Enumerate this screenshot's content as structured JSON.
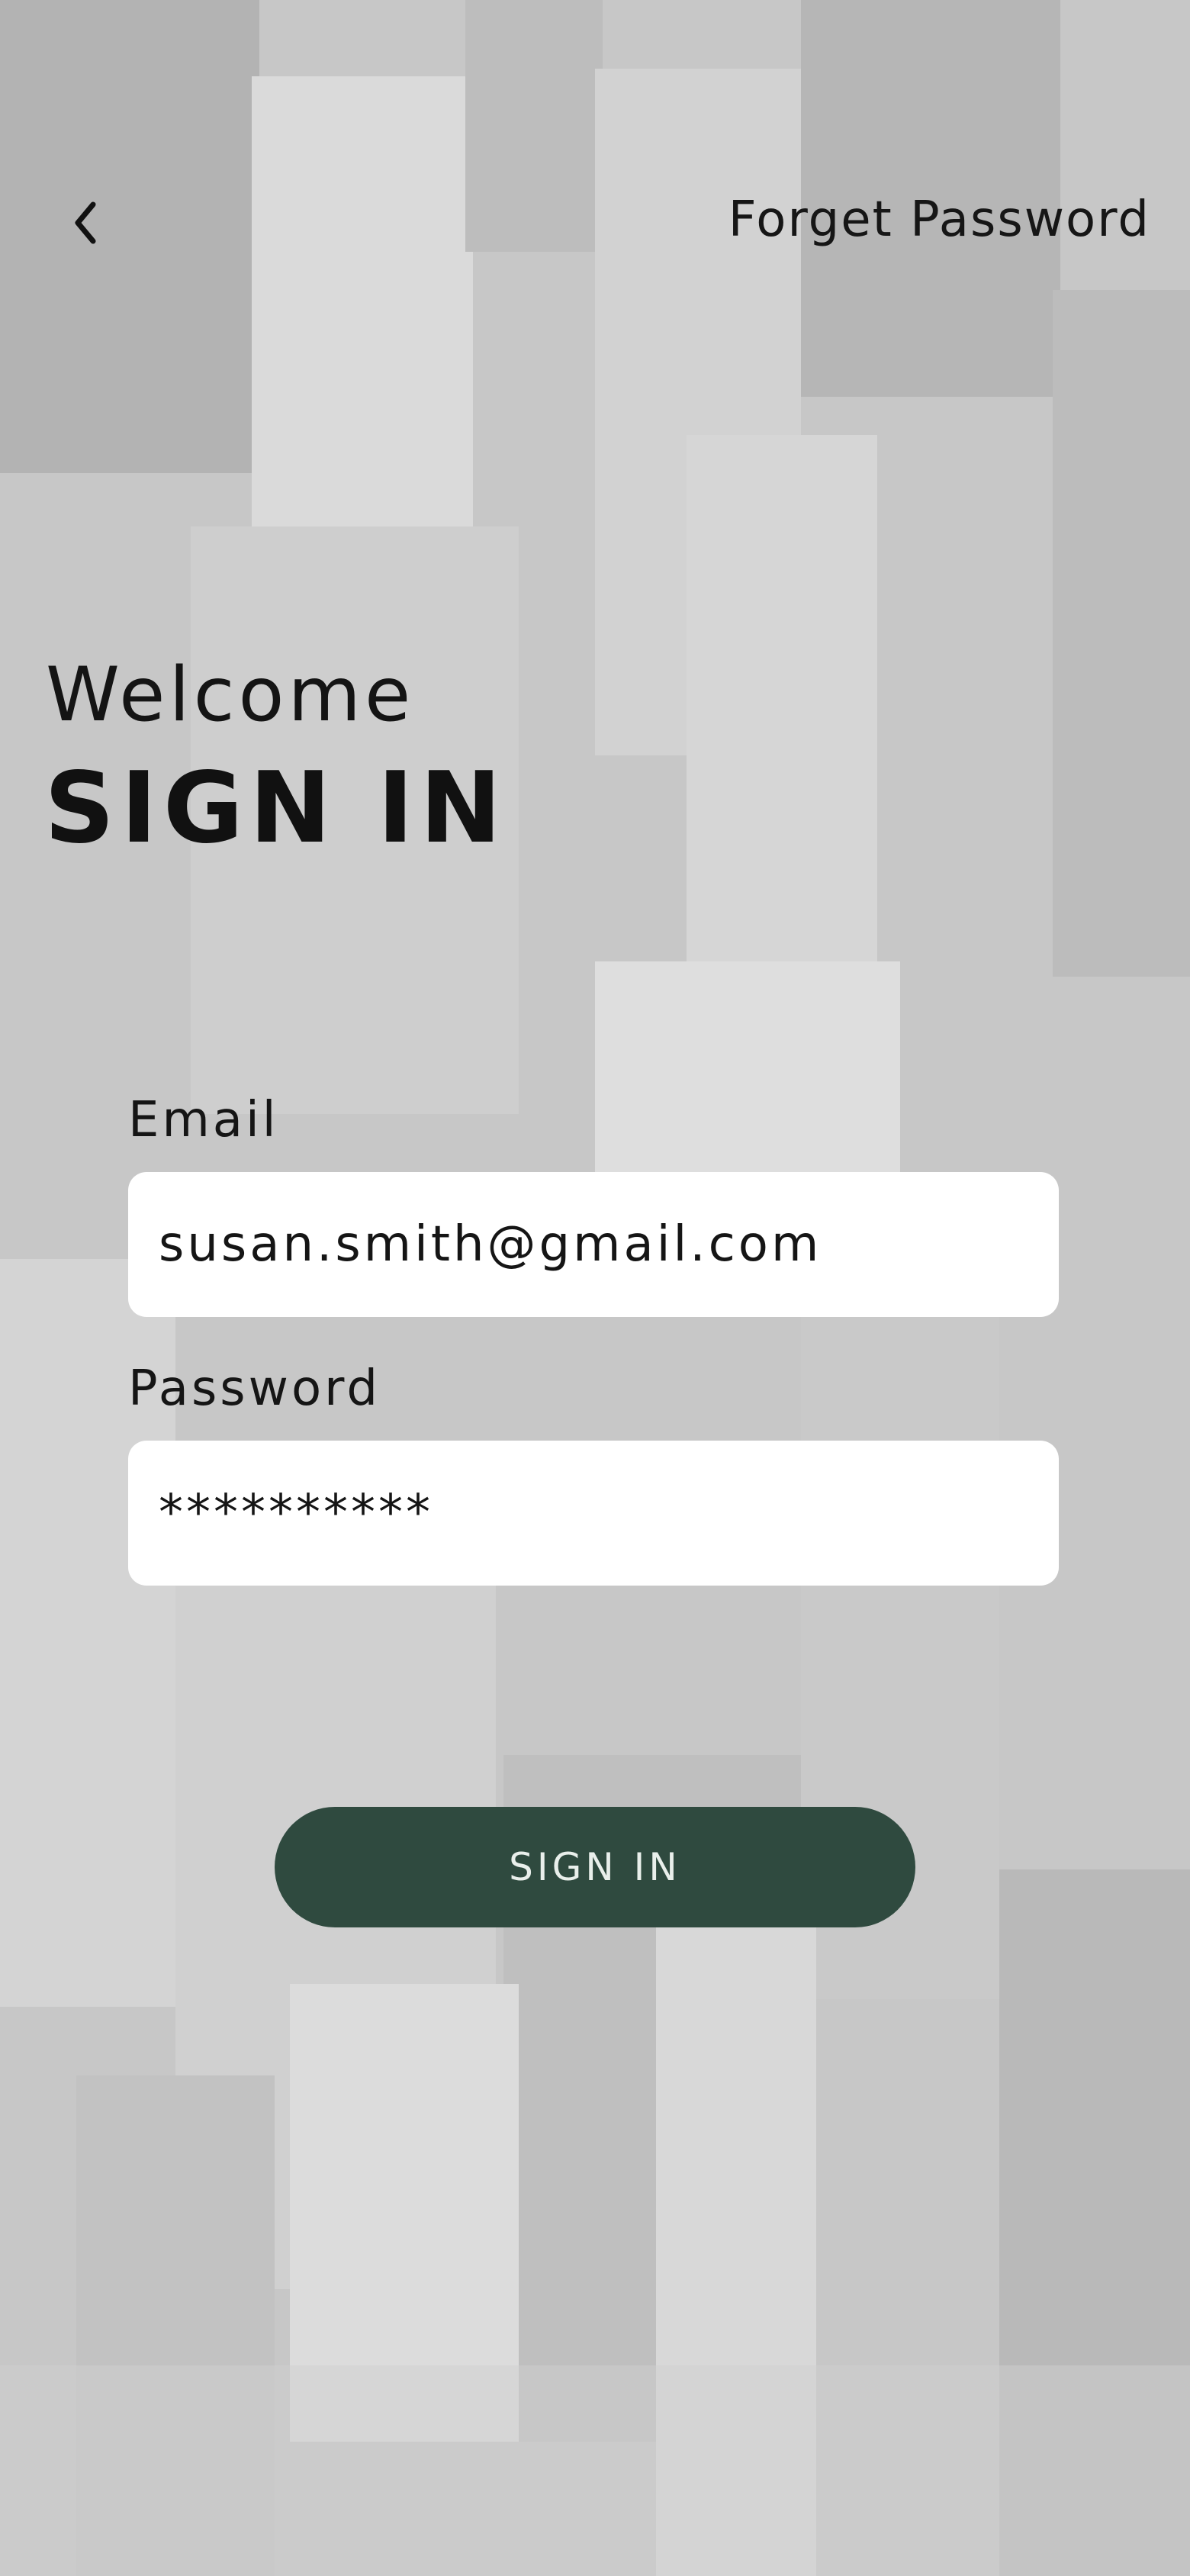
{
  "header": {
    "back_icon": "chevron-left-icon",
    "forget_password_label": "Forget Password"
  },
  "title": {
    "welcome": "Welcome",
    "heading": "SIGN IN"
  },
  "form": {
    "email_label": "Email",
    "email_value": "susan.smith@gmail.com",
    "password_label": "Password",
    "password_value": "**********",
    "submit_label": "SIGN IN"
  },
  "colors": {
    "button_background": "#2f4a3f",
    "button_text": "#e9efeb",
    "input_background": "#ffffff",
    "text_dark": "#111111"
  }
}
